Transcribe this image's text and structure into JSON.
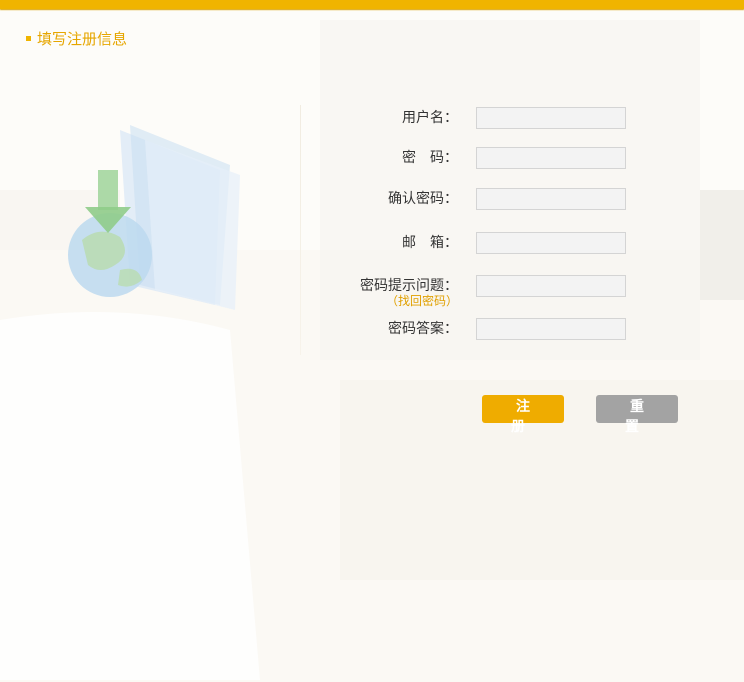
{
  "header": {
    "accent_color": "#f0b400"
  },
  "section": {
    "title": "填写注册信息"
  },
  "form": {
    "username_label": "用户名：",
    "password_label": "密　码：",
    "confirm_label": "确认密码：",
    "email_label": "邮　箱：",
    "question_label": "密码提示问题：",
    "recover_link": "（找回密码）",
    "answer_label": "密码答案："
  },
  "buttons": {
    "register": "注 册",
    "reset": "重 置"
  }
}
